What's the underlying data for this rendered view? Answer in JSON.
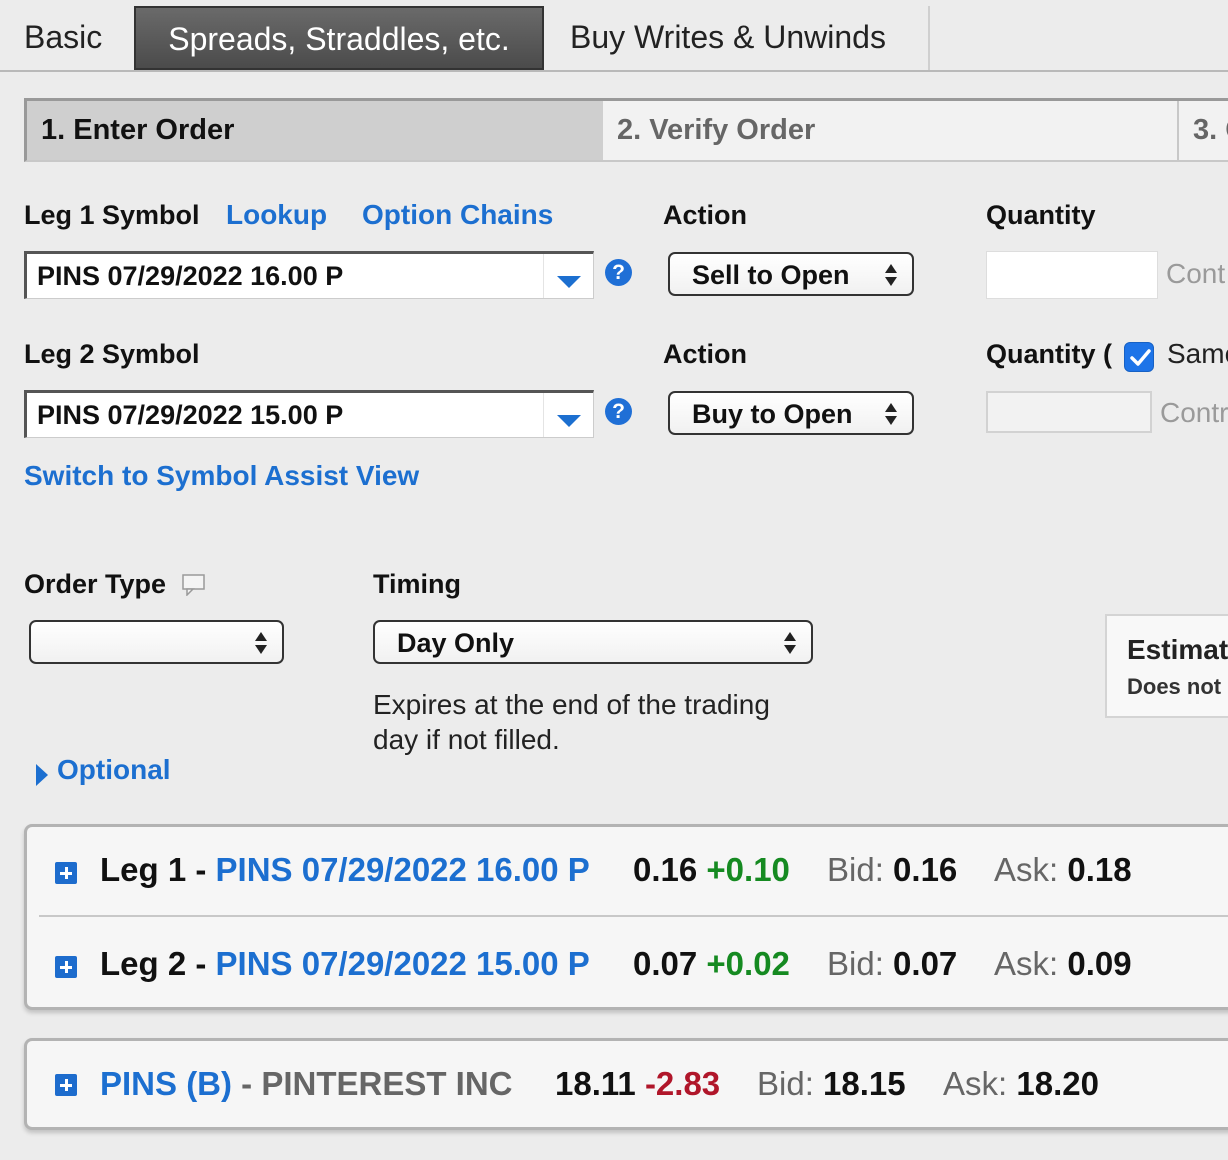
{
  "tabs": [
    {
      "label": "Basic",
      "active": false
    },
    {
      "label": "Spreads, Straddles, etc.",
      "active": true
    },
    {
      "label": "Buy Writes & Unwinds",
      "active": false
    }
  ],
  "steps": {
    "step1": "1. Enter Order",
    "step2": "2. Verify Order",
    "step3": "3. C"
  },
  "leg1": {
    "label": "Leg 1 Symbol",
    "lookup": "Lookup",
    "option_chains": "Option Chains",
    "symbol": "PINS 07/29/2022 16.00 P",
    "action_label": "Action",
    "action": "Sell to Open",
    "quantity_label": "Quantity",
    "quantity_value": "",
    "quantity_suffix": "Cont"
  },
  "leg2": {
    "label": "Leg 2 Symbol",
    "symbol": "PINS 07/29/2022 15.00 P",
    "action_label": "Action",
    "action": "Buy to Open",
    "quantity_label": "Quantity (",
    "same_label": "Same",
    "same_checked": true,
    "quantity_value": "",
    "quantity_suffix": "Contr"
  },
  "switch_view": "Switch to Symbol Assist View",
  "order_type": {
    "label": "Order Type",
    "value": ""
  },
  "timing": {
    "label": "Timing",
    "value": "Day Only",
    "help_line1": "Expires at the end of the trading",
    "help_line2": "day if not filled."
  },
  "estimate": {
    "title": "Estimat",
    "sub": "Does not"
  },
  "optional": "Optional",
  "quotes": {
    "legs": [
      {
        "name": "Leg 1",
        "dash": " - ",
        "symbol": "PINS 07/29/2022 16.00 P",
        "last": "0.16",
        "change": "+0.10",
        "bid_label": "Bid: ",
        "bid": "0.16",
        "ask_label": "Ask: ",
        "ask": "0.18"
      },
      {
        "name": "Leg 2",
        "dash": " - ",
        "symbol": "PINS 07/29/2022 15.00 P",
        "last": "0.07",
        "change": "+0.02",
        "bid_label": "Bid: ",
        "bid": "0.07",
        "ask_label": "Ask: ",
        "ask": "0.09"
      }
    ],
    "underlying": {
      "symbol": "PINS (B)",
      "dash": " - ",
      "name": "PINTEREST INC",
      "last": "18.11",
      "change": "-2.83",
      "bid_label": "Bid: ",
      "bid": "18.15",
      "ask_label": "Ask: ",
      "ask": "18.20"
    }
  },
  "colors": {
    "link": "#1c6fd0",
    "positive": "#158a21",
    "negative": "#b0162a",
    "active_tab": "#4b4b4b"
  }
}
